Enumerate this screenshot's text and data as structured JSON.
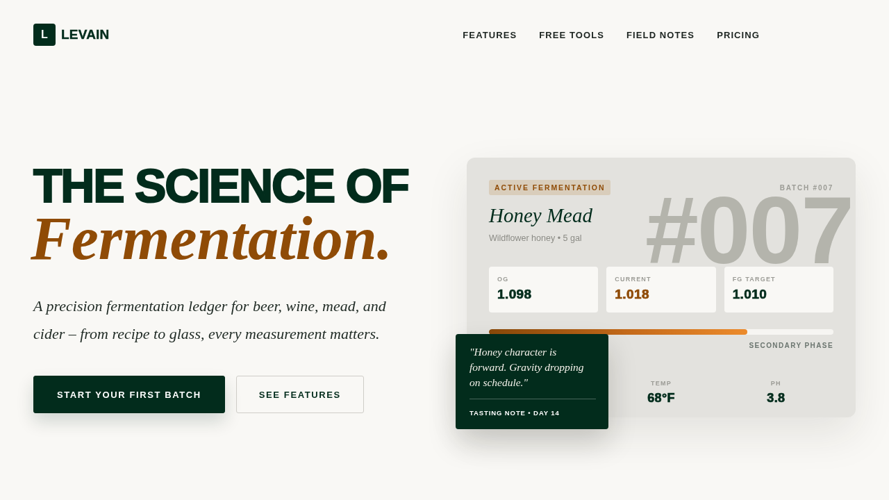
{
  "nav": {
    "logo_mark": "L",
    "brand": "LEVAIN",
    "links": [
      "FEATURES",
      "FREE TOOLS",
      "FIELD NOTES",
      "PRICING"
    ]
  },
  "hero": {
    "headline": "THE SCIENCE OF",
    "headline_accent": "Fermentation.",
    "description": "A precision fermentation ledger for beer, wine, mead, and cider – from recipe to glass, every measurement matters.",
    "buttons": [
      {
        "label": "START YOUR FIRST BATCH",
        "kind": "primary"
      },
      {
        "label": "SEE FEATURES",
        "kind": "secondary"
      }
    ]
  },
  "batch_card": {
    "status": "ACTIVE FERMENTATION",
    "batch_label": "BATCH #007",
    "big_number": "#007",
    "name": "Honey Mead",
    "details": "Wildflower honey • 5 gal",
    "gravity": [
      {
        "label": "OG",
        "value": "1.098",
        "highlight": false
      },
      {
        "label": "CURRENT",
        "value": "1.018",
        "highlight": true
      },
      {
        "label": "FG TARGET",
        "value": "1.010",
        "highlight": false
      }
    ],
    "progress": {
      "level": 0.75,
      "phase": "SECONDARY PHASE"
    },
    "readings": [
      {
        "label": "TEMP",
        "value": "68°F"
      },
      {
        "label": "PH",
        "value": "3.8"
      }
    ],
    "tasting_note": {
      "quote": "\"Honey character is forward. Gravity dropping on schedule.\"",
      "caption": "TASTING NOTE • DAY 14"
    }
  }
}
